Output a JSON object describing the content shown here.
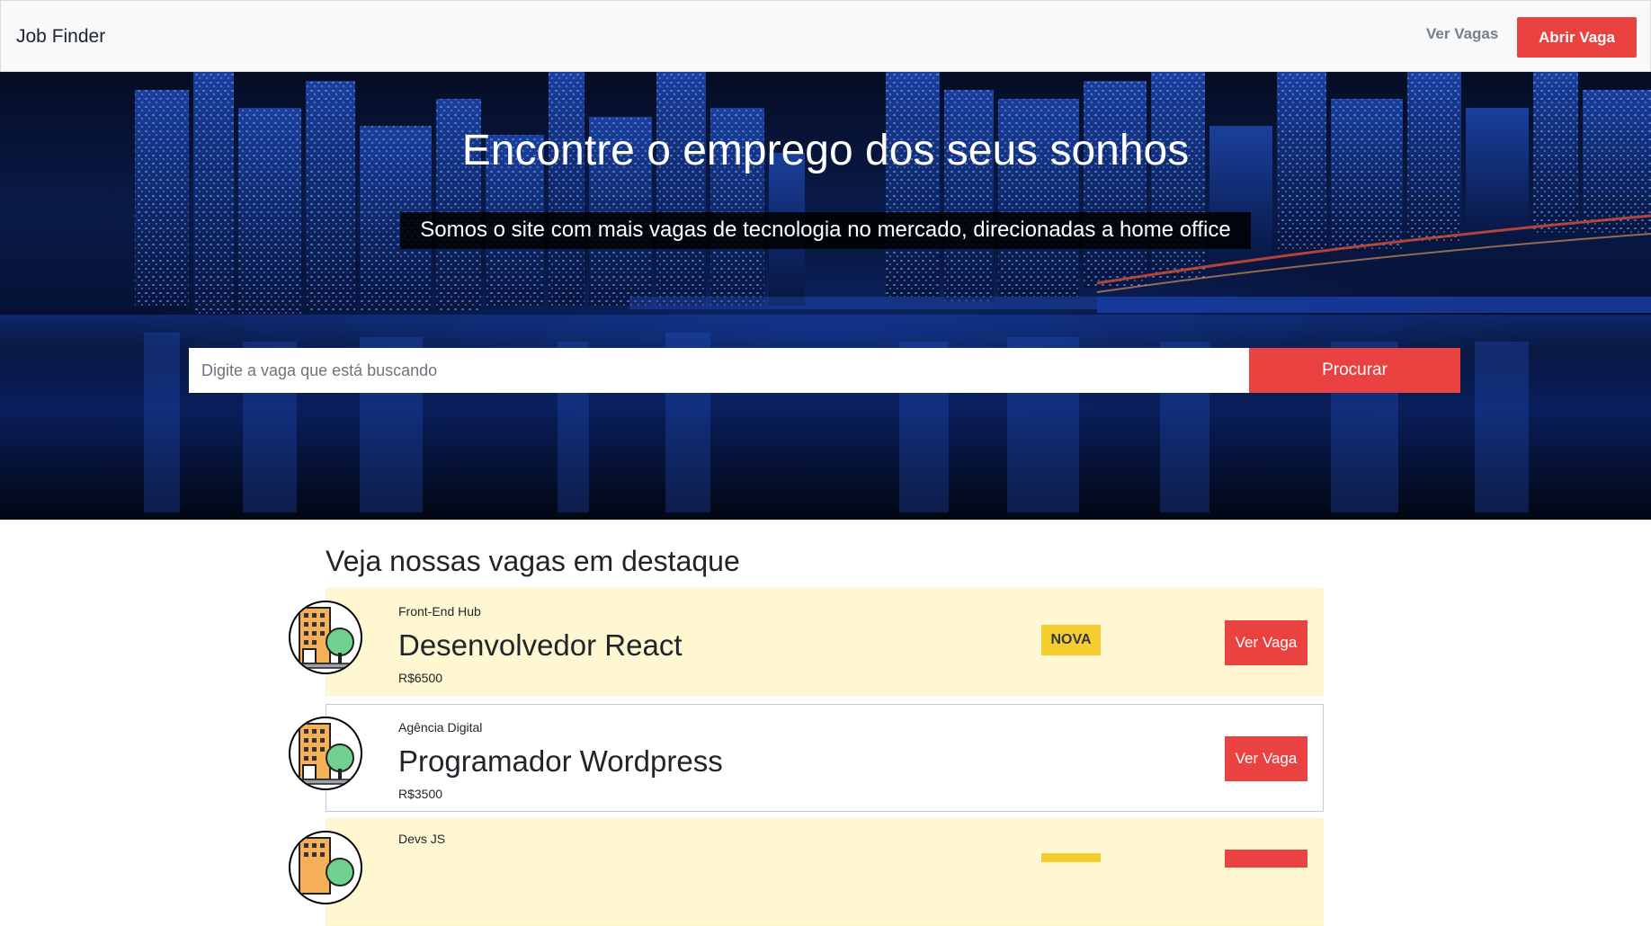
{
  "navbar": {
    "brand": "Job Finder",
    "link_label": "Ver Vagas",
    "button_label": "Abrir Vaga"
  },
  "hero": {
    "title": "Encontre o emprego dos seus sonhos",
    "subtitle": "Somos o site com mais vagas de tecnologia no mercado, direcionadas a home office"
  },
  "search": {
    "placeholder": "Digite a vaga que está buscando",
    "value": "",
    "button_label": "Procurar"
  },
  "jobs_section": {
    "title": "Veja nossas vagas em destaque",
    "jobs": [
      {
        "company": "Front-End Hub",
        "title": "Desenvolvedor React",
        "salary": "R$6500",
        "badge": "NOVA",
        "button_label": "Ver Vaga",
        "logo_icon": "building-tree-icon"
      },
      {
        "company": "Agência Digital",
        "title": "Programador Wordpress",
        "salary": "R$3500",
        "badge": "",
        "button_label": "Ver Vaga",
        "logo_icon": "building-tree-icon"
      },
      {
        "company": "Devs JS",
        "title": "",
        "salary": "",
        "badge": "",
        "button_label": "",
        "logo_icon": "building-tree-icon"
      }
    ]
  },
  "colors": {
    "accent": "#ea4141",
    "featured_bg": "#fff7d1",
    "badge_bg": "#f6cd2f",
    "navbar_bg": "#f8f9fa"
  }
}
